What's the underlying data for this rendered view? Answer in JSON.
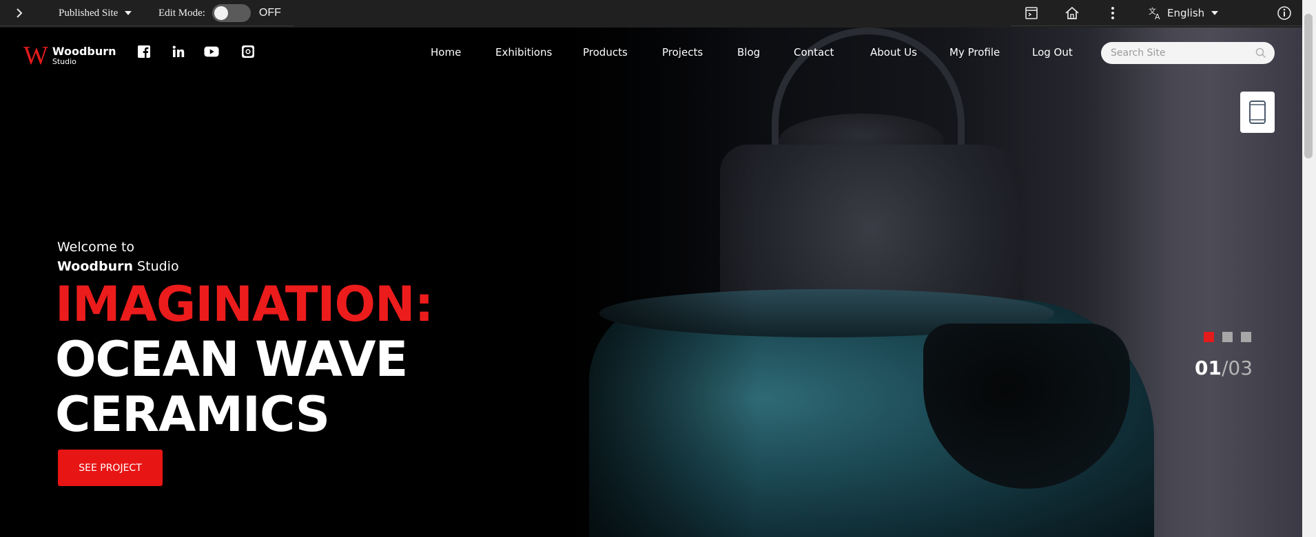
{
  "admin_bar": {
    "site_selector": "Published Site",
    "edit_mode_label": "Edit Mode:",
    "edit_mode_state": "OFF",
    "language": "English"
  },
  "site": {
    "logo_mark": "W",
    "logo_name": "Woodburn",
    "logo_sub": "Studio"
  },
  "nav": {
    "items": [
      "Home",
      "Exhibitions",
      "Products",
      "Projects",
      "Blog",
      "Contact",
      "About Us",
      "My Profile",
      "Log Out"
    ]
  },
  "search": {
    "placeholder": "Search Site"
  },
  "hero": {
    "welcome": "Welcome to",
    "studio_bold": "Woodburn",
    "studio_rest": " Studio",
    "headline_red": "IMAGINATION:",
    "headline_line2": "OCEAN WAVE",
    "headline_line3": "CERAMICS",
    "cta_label": "SEE PROJECT"
  },
  "slider": {
    "current": "01",
    "separator": "/",
    "total": "03",
    "active_index": 0,
    "dot_count": 3
  },
  "colors": {
    "accent_red": "#e81515",
    "admin_bg": "#202020"
  },
  "icons": [
    "chevron-right-icon",
    "caret-down-icon",
    "preview-panel-icon",
    "home-icon",
    "kebab-menu-icon",
    "translate-icon",
    "info-icon",
    "facebook-icon",
    "linkedin-icon",
    "youtube-icon",
    "instagram-icon",
    "search-icon",
    "tablet-icon"
  ]
}
